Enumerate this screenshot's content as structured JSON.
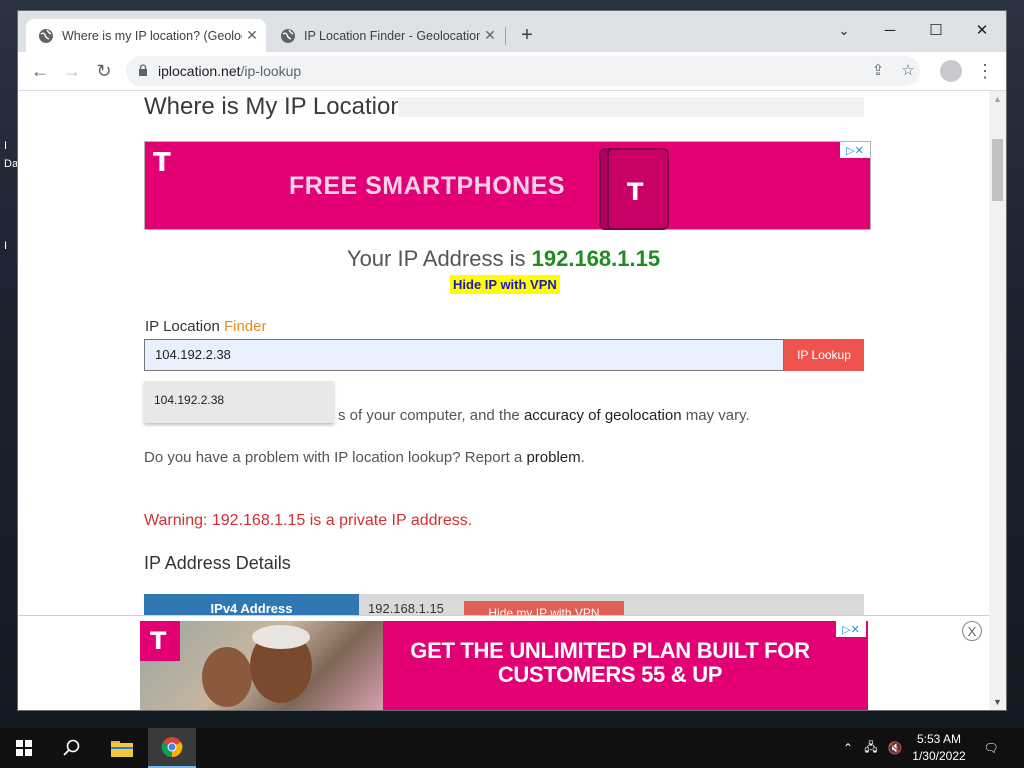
{
  "browser": {
    "tabs": [
      {
        "title": "Where is my IP location? (Geoloc",
        "active": true
      },
      {
        "title": "IP Location Finder - Geolocation",
        "active": false
      }
    ],
    "address_domain": "iplocation.net",
    "address_path": "/ip-lookup"
  },
  "page": {
    "heading": "Where is My IP Location?",
    "ad_top": {
      "text": "FREE SMARTPHONES",
      "logo": "T",
      "adchoice": "▷✕"
    },
    "ip_prefix": "Your IP Address is",
    "ip_value": "192.168.1.15",
    "vpn_link": "Hide IP with VPN",
    "finder_label_main": "IP Location",
    "finder_label_accent": "Finder",
    "finder_input_value": "104.192.2.38",
    "lookup_button": "IP Lookup",
    "autocomplete_item": "104.192.2.38",
    "para1_part1": "s of your computer, and the",
    "para1_link": "accuracy of geolocation",
    "para1_part2": "may vary.",
    "para2_part1": "Do you have a problem with IP location lookup? Report a",
    "para2_link": "problem",
    "para2_end": ".",
    "warning": "Warning: 192.168.1.15 is a private IP address.",
    "section_title": "IP Address Details",
    "table": {
      "key": "IPv4 Address",
      "value": "192.168.1.15",
      "button": "Hide my IP with VPN"
    },
    "ad_bottom": {
      "text_line1": "GET THE UNLIMITED PLAN BUILT FOR",
      "text_line2": "CUSTOMERS 55 & UP",
      "logo": "T",
      "close": "X"
    }
  },
  "taskbar": {
    "time": "5:53 AM",
    "date": "1/30/2022"
  },
  "desktop": {
    "icon_labels": [
      "I",
      "Da",
      "I"
    ]
  },
  "colors": {
    "brand": "#e20074",
    "ip_green": "#228b22",
    "warning_red": "#d32f2f",
    "finder_orange": "#e78a1c",
    "lookup_red": "#ef5350"
  }
}
